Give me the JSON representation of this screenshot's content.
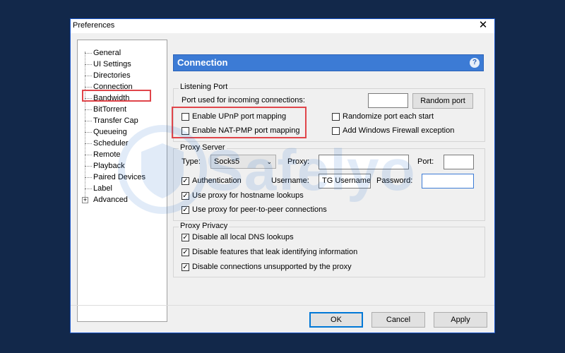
{
  "window": {
    "title": "Preferences",
    "close_glyph": "✕"
  },
  "tree": {
    "items": [
      {
        "label": "General"
      },
      {
        "label": "UI Settings"
      },
      {
        "label": "Directories"
      },
      {
        "label": "Connection",
        "selected": true
      },
      {
        "label": "Bandwidth"
      },
      {
        "label": "BitTorrent"
      },
      {
        "label": "Transfer Cap"
      },
      {
        "label": "Queueing"
      },
      {
        "label": "Scheduler"
      },
      {
        "label": "Remote"
      },
      {
        "label": "Playback"
      },
      {
        "label": "Paired Devices"
      },
      {
        "label": "Label"
      },
      {
        "label": "Advanced",
        "expandable": true
      }
    ],
    "expander_glyph": "+"
  },
  "header": {
    "title": "Connection",
    "help_glyph": "?"
  },
  "listening": {
    "title": "Listening Port",
    "port_label": "Port used for incoming connections:",
    "port_value": "",
    "random_port_button": "Random port",
    "upnp": {
      "label": "Enable UPnP port mapping",
      "checked": false
    },
    "natpmp": {
      "label": "Enable NAT-PMP port mapping",
      "checked": false
    },
    "randomize": {
      "label": "Randomize port each start",
      "checked": false
    },
    "firewall": {
      "label": "Add Windows Firewall exception",
      "checked": false
    }
  },
  "proxy_server": {
    "title": "Proxy Server",
    "type_label": "Type:",
    "type_value": "Socks5",
    "proxy_label": "Proxy:",
    "proxy_value": "",
    "port_label": "Port:",
    "port_value": "",
    "authentication": {
      "label": "Authentication",
      "checked": true
    },
    "username_label": "Username:",
    "username_value": "TG Username",
    "password_label": "Password:",
    "password_value": "",
    "hostname_lookups": {
      "label": "Use proxy for hostname lookups",
      "checked": true
    },
    "p2p": {
      "label": "Use proxy for peer-to-peer connections",
      "checked": true
    }
  },
  "proxy_privacy": {
    "title": "Proxy Privacy",
    "dns": {
      "label": "Disable all local DNS lookups",
      "checked": true
    },
    "leak": {
      "label": "Disable features that leak identifying information",
      "checked": true
    },
    "unsupported": {
      "label": "Disable connections unsupported by the proxy",
      "checked": true
    }
  },
  "buttons": {
    "ok": "OK",
    "cancel": "Cancel",
    "apply": "Apply"
  },
  "check_glyph": "✓",
  "dropdown_glyph": "⌄",
  "watermark": {
    "text": "Safelyo"
  },
  "colors": {
    "accent": "#3c7bd5",
    "highlight": "#e0454a",
    "background": "#12284a"
  }
}
